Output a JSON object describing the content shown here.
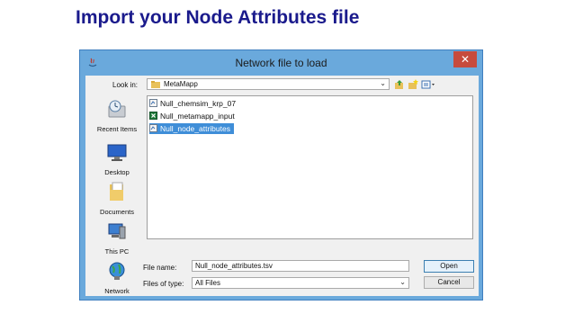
{
  "slide": {
    "title": "Import your Node Attributes file"
  },
  "window": {
    "title": "Network file to load",
    "close_glyph": "✕"
  },
  "toolbar": {
    "look_in_label": "Look in:",
    "look_in_value": "MetaMapp",
    "icons": [
      "up-folder-icon",
      "new-folder-icon",
      "view-menu-icon"
    ]
  },
  "places": [
    {
      "label": "Recent Items",
      "icon": "recent-items-icon"
    },
    {
      "label": "Desktop",
      "icon": "desktop-icon"
    },
    {
      "label": "Documents",
      "icon": "documents-icon"
    },
    {
      "label": "This PC",
      "icon": "this-pc-icon"
    },
    {
      "label": "Network",
      "icon": "network-icon"
    }
  ],
  "files": [
    {
      "name": "Null_chemsim_krp_07",
      "icon": "file-icon",
      "selected": false
    },
    {
      "name": "Null_metamapp_input",
      "icon": "excel-file-icon",
      "selected": false
    },
    {
      "name": "Null_node_attributes",
      "icon": "file-icon",
      "selected": true
    }
  ],
  "form": {
    "file_name_label": "File name:",
    "file_name_value": "Null_node_attributes.tsv",
    "files_of_type_label": "Files of type:",
    "files_of_type_value": "All Files"
  },
  "buttons": {
    "open": "Open",
    "cancel": "Cancel"
  },
  "colors": {
    "title_blue": "#1a1a8c",
    "window_frame": "#6aa9dc",
    "selection": "#3f8ed8",
    "close_red": "#c74b3d"
  }
}
